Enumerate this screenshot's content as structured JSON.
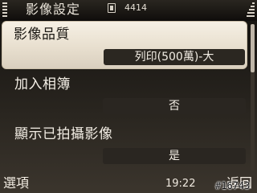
{
  "status": {
    "title": "影像設定",
    "network_text": "4414",
    "icons": {
      "signal": "signal-strength-icon",
      "network": "data-connection-icon",
      "battery": "battery-icon"
    }
  },
  "settings": [
    {
      "label": "影像品質",
      "value": "列印(500萬)-大"
    },
    {
      "label": "加入相簿",
      "value": "否"
    },
    {
      "label": "顯示已拍攝影像",
      "value": "是"
    }
  ],
  "softkeys": {
    "left": "選項",
    "time": "19:22",
    "right": "返回"
  },
  "watermark": "#16743",
  "colors": {
    "background": "#1e1b17",
    "selected_row": "#e8dfcf",
    "value_box": "#2a2621"
  }
}
